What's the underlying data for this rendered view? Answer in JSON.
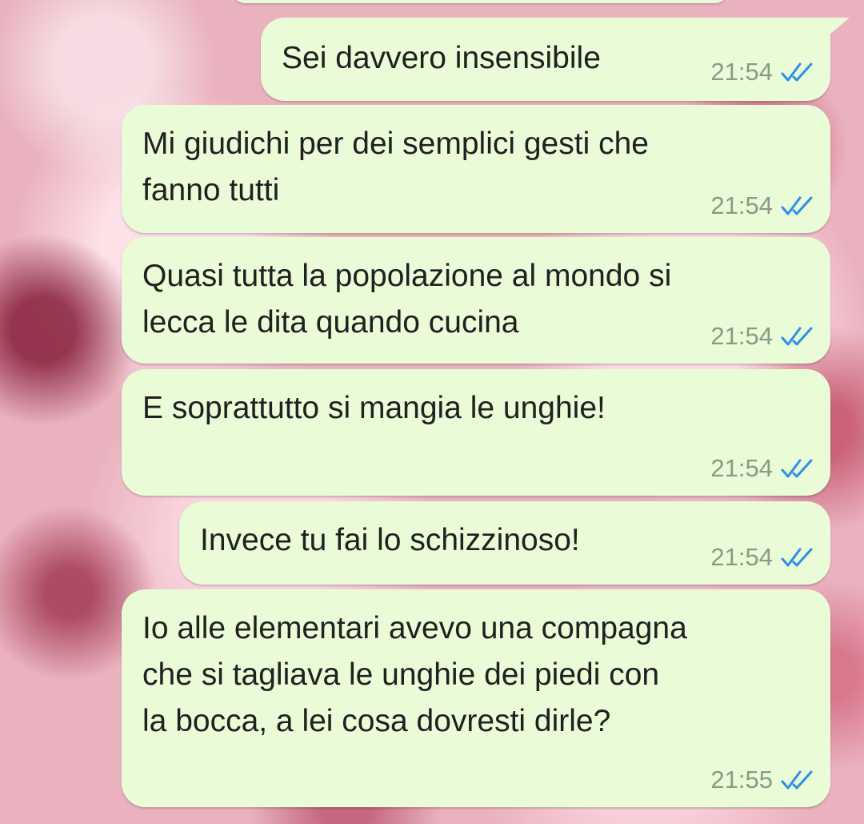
{
  "chat": {
    "accent_tick_color": "#2f8fe6",
    "bubble_color": "#e9fbd7",
    "messages": [
      {
        "text": "Sei davvero insensibile",
        "time": "21:54",
        "status": "read"
      },
      {
        "text": "Mi giudichi per dei semplici gesti che\nfanno tutti",
        "time": "21:54",
        "status": "read"
      },
      {
        "text": "Quasi tutta la popolazione al mondo si\nlecca le dita quando cucina",
        "time": "21:54",
        "status": "read"
      },
      {
        "text": "E soprattutto si mangia le unghie!",
        "time": "21:54",
        "status": "read"
      },
      {
        "text": "Invece tu fai lo schizzinoso!",
        "time": "21:54",
        "status": "read"
      },
      {
        "text": "Io alle elementari avevo una compagna\nche si tagliava le unghie dei piedi con\nla bocca, a lei cosa dovresti dirle?",
        "time": "21:55",
        "status": "read"
      }
    ]
  }
}
